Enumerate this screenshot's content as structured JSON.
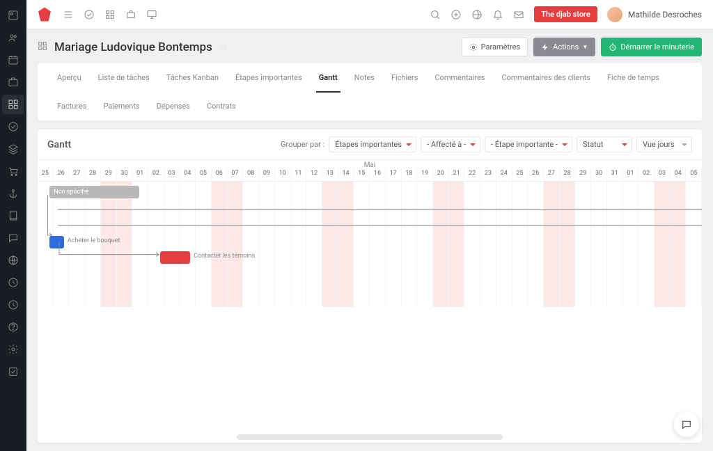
{
  "topbar": {
    "store_btn": "The djab store",
    "user_name": "Mathilde Desroches"
  },
  "project": {
    "title": "Mariage Ludovique Bontemps",
    "settings_btn": "Paramètres",
    "actions_btn": "Actions",
    "timer_btn": "Démarrer le minuterie"
  },
  "tabs": [
    "Aperçu",
    "Liste de tâches",
    "Tâches Kanban",
    "Étapes importantes",
    "Gantt",
    "Notes",
    "Fichiers",
    "Commentaires",
    "Commentaires des clients",
    "Fiche de temps",
    "Factures",
    "Paiements",
    "Dépenses",
    "Contrats"
  ],
  "active_tab": "Gantt",
  "gantt": {
    "title": "Gantt",
    "group_label": "Grouper par :",
    "filters": {
      "milestone": "Étapes importantes",
      "assigned": "- Affecté à -",
      "milestone2": "- Étape importante -",
      "status": "Statut",
      "view": "Vue jours"
    },
    "month": "Mai",
    "days": [
      "25",
      "26",
      "27",
      "28",
      "29",
      "30",
      "01",
      "02",
      "03",
      "04",
      "05",
      "06",
      "07",
      "08",
      "09",
      "10",
      "11",
      "12",
      "13",
      "14",
      "15",
      "16",
      "17",
      "18",
      "19",
      "20",
      "21",
      "22",
      "23",
      "24",
      "25",
      "26",
      "27",
      "28",
      "29",
      "30",
      "31",
      "01",
      "02",
      "03",
      "04",
      "05"
    ],
    "weekend_idx": [
      4,
      5,
      11,
      12,
      18,
      19,
      25,
      26,
      32,
      33,
      39,
      40
    ],
    "bars": {
      "unspecified": "Non spécifié",
      "task1": "Acheter le bouquet",
      "task2": "Contacter les témoins"
    }
  }
}
